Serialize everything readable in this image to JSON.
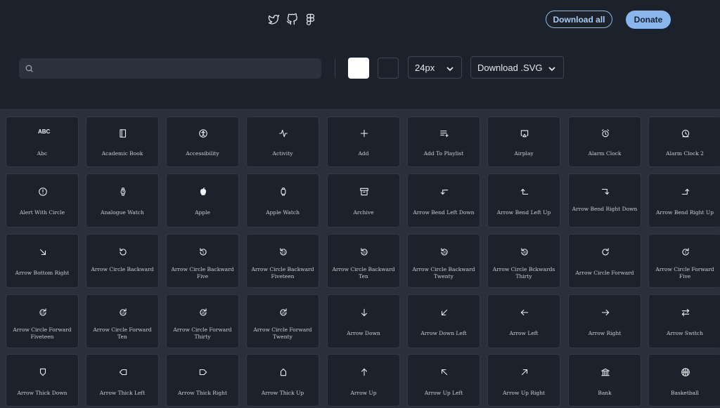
{
  "header": {
    "social": [
      {
        "icon": "twitter-icon"
      },
      {
        "icon": "github-icon"
      },
      {
        "icon": "figma-icon"
      }
    ],
    "download_all_label": "Download all",
    "donate_label": "Donate"
  },
  "toolbar": {
    "search_value": "",
    "search_placeholder": "",
    "colors": {
      "light": "#ffffff",
      "dark": "#1c222c"
    },
    "size_value": "24px",
    "format_value": "Download .SVG"
  },
  "icons": [
    {
      "name": "Abc",
      "icon": "abc-icon"
    },
    {
      "name": "Academic Book",
      "icon": "academic-book-icon"
    },
    {
      "name": "Accessibility",
      "icon": "accessibility-icon"
    },
    {
      "name": "Activity",
      "icon": "activity-icon"
    },
    {
      "name": "Add",
      "icon": "add-icon"
    },
    {
      "name": "Add To Playlist",
      "icon": "add-to-playlist-icon"
    },
    {
      "name": "Airplay",
      "icon": "airplay-icon"
    },
    {
      "name": "Alarm Clock",
      "icon": "alarm-clock-icon"
    },
    {
      "name": "Alarm Clock 2",
      "icon": "alarm-clock-2-icon"
    },
    {
      "name": "Alert With Circle",
      "icon": "alert-circle-icon"
    },
    {
      "name": "Analogue Watch",
      "icon": "analogue-watch-icon"
    },
    {
      "name": "Apple",
      "icon": "apple-icon"
    },
    {
      "name": "Apple Watch",
      "icon": "apple-watch-icon"
    },
    {
      "name": "Archive",
      "icon": "archive-icon"
    },
    {
      "name": "Arrow Bend Left Down",
      "icon": "arrow-bend-left-down-icon"
    },
    {
      "name": "Arrow Bend Left Up",
      "icon": "arrow-bend-left-up-icon"
    },
    {
      "name": "Arrow Bend Right Down",
      "icon": "arrow-bend-right-down-icon"
    },
    {
      "name": "Arrow Bend Right Up",
      "icon": "arrow-bend-right-up-icon"
    },
    {
      "name": "Arrow Bottom Right",
      "icon": "arrow-bottom-right-icon"
    },
    {
      "name": "Arrow Circle Backward",
      "icon": "arrow-circle-backward-icon"
    },
    {
      "name": "Arrow Circle Backward Five",
      "icon": "arrow-circle-backward-five-icon"
    },
    {
      "name": "Arrow Circle Backward Fiveteen",
      "icon": "arrow-circle-backward-fifteen-icon"
    },
    {
      "name": "Arrow Circle Backward Ten",
      "icon": "arrow-circle-backward-ten-icon"
    },
    {
      "name": "Arrow Circle Backward Twenty",
      "icon": "arrow-circle-backward-twenty-icon"
    },
    {
      "name": "Arrow Circle Bckwards Thirty",
      "icon": "arrow-circle-backward-thirty-icon"
    },
    {
      "name": "Arrow Circle Forward",
      "icon": "arrow-circle-forward-icon"
    },
    {
      "name": "Arrow Circle Forward Five",
      "icon": "arrow-circle-forward-five-icon"
    },
    {
      "name": "Arrow Circle Forward Fiveteen",
      "icon": "arrow-circle-forward-fifteen-icon"
    },
    {
      "name": "Arrow Circle Forward Ten",
      "icon": "arrow-circle-forward-ten-icon"
    },
    {
      "name": "Arrow Circle Forward Thirty",
      "icon": "arrow-circle-forward-thirty-icon"
    },
    {
      "name": "Arrow Circle Forward Twenty",
      "icon": "arrow-circle-forward-twenty-icon"
    },
    {
      "name": "Arrow Down",
      "icon": "arrow-down-icon"
    },
    {
      "name": "Arrow Down Left",
      "icon": "arrow-down-left-icon"
    },
    {
      "name": "Arrow Left",
      "icon": "arrow-left-icon"
    },
    {
      "name": "Arrow Right",
      "icon": "arrow-right-icon"
    },
    {
      "name": "Arrow Switch",
      "icon": "arrow-switch-icon"
    },
    {
      "name": "Arrow Thick Down",
      "icon": "arrow-thick-down-icon"
    },
    {
      "name": "Arrow Thick Left",
      "icon": "arrow-thick-left-icon"
    },
    {
      "name": "Arrow Thick Right",
      "icon": "arrow-thick-right-icon"
    },
    {
      "name": "Arrow Thick Up",
      "icon": "arrow-thick-up-icon"
    },
    {
      "name": "Arrow Up",
      "icon": "arrow-up-icon"
    },
    {
      "name": "Arrow Up Left",
      "icon": "arrow-up-left-icon"
    },
    {
      "name": "Arrow Up Right",
      "icon": "arrow-up-right-icon"
    },
    {
      "name": "Bank",
      "icon": "bank-icon"
    },
    {
      "name": "Basketball",
      "icon": "basketball-icon"
    }
  ]
}
